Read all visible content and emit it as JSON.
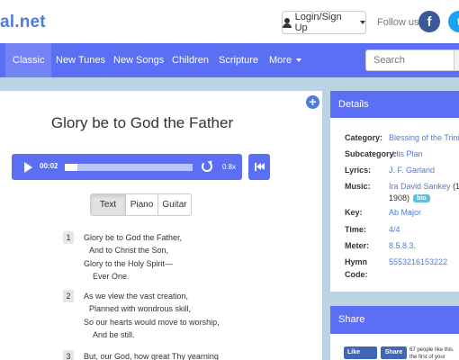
{
  "header": {
    "logo_text": "al.net",
    "login_label": "Login/Sign Up",
    "follow_label": "Follow us:",
    "facebook_glyph": "f",
    "twitter_glyph": "t"
  },
  "nav": {
    "items": [
      {
        "label": "Classic",
        "active": true
      },
      {
        "label": "New Tunes"
      },
      {
        "label": "New Songs"
      },
      {
        "label": "Children"
      },
      {
        "label": "Scripture"
      },
      {
        "label": "More"
      }
    ],
    "search_placeholder": "Search"
  },
  "hymn": {
    "title": "Glory be to God the Father",
    "player": {
      "current_time": "00:02",
      "progress_fraction": 0.1,
      "speed": "0.8x"
    },
    "tabs": [
      "Text",
      "Piano",
      "Guitar"
    ],
    "active_tab": "Text",
    "verses": [
      {
        "number": "1",
        "lines": [
          "Glory be to God the Father,",
          "And to Christ the Son,",
          "Glory to the Holy Spirit—",
          "Ever One."
        ]
      },
      {
        "number": "2",
        "lines": [
          "As we view the vast creation,",
          "Planned with wondrous skill,",
          "So our hearts would move to worship,",
          "And be still."
        ]
      },
      {
        "number": "3",
        "lines": [
          "But, our God, how great Thy yearning"
        ]
      }
    ]
  },
  "details": {
    "heading": "Details",
    "category_label": "Category:",
    "category_value": "Blessing of the Trini",
    "subcategory_label": "Subcategory:",
    "subcategory_value": "His Plan",
    "lyrics_label": "Lyrics:",
    "lyrics_value": "J. F. Garland",
    "music_label": "Music:",
    "music_value": "Ira David Sankey",
    "music_paren": "(1",
    "music_year": "1908)",
    "bio_label": "bio",
    "key_label": "Key:",
    "key_value": "Ab Major",
    "time_label": "Time:",
    "time_value": "4/4",
    "meter_label": "Meter:",
    "meter_value": "8.5.8.3.",
    "hymn_code_label_1": "Hymn",
    "hymn_code_label_2": "Code:",
    "hymn_code_value": "5553216153222"
  },
  "share": {
    "heading": "Share",
    "like_label": "Like",
    "share_label": "Share",
    "like_text": "67 people like this. the first of your"
  },
  "colors": {
    "accent": "#5b6ff5",
    "link": "#4f7cd6",
    "background": "#bcd3e4"
  }
}
